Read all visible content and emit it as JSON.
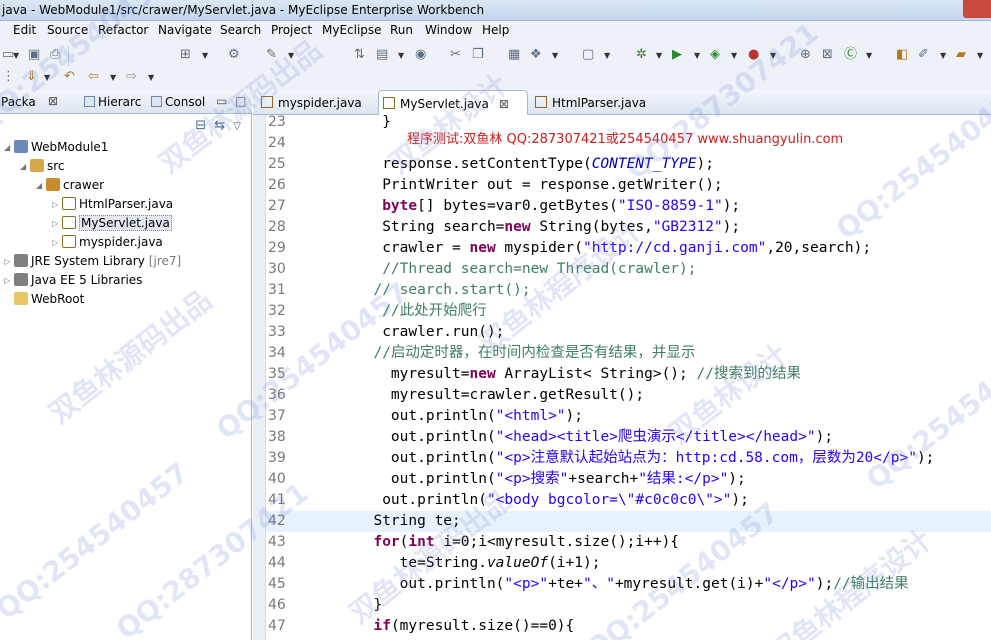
{
  "window": {
    "title": "java - WebModule1/src/crawer/MyServlet.java - MyEclipse Enterprise Workbench"
  },
  "menu": [
    "Edit",
    "Source",
    "Refactor",
    "Navigate",
    "Search",
    "Project",
    "MyEclipse",
    "Run",
    "Window",
    "Help"
  ],
  "left_panel": {
    "tabs": [
      {
        "label": "Packa"
      },
      {
        "label": "Hierarc"
      },
      {
        "label": "Consol"
      }
    ],
    "tree": [
      {
        "label": "WebModule1",
        "depth": 0,
        "icon": "project-icon",
        "twisty": "open"
      },
      {
        "label": "src",
        "depth": 1,
        "icon": "source-folder-icon",
        "twisty": "open"
      },
      {
        "label": "crawer",
        "depth": 2,
        "icon": "package-icon",
        "twisty": "open"
      },
      {
        "label": "HtmlParser.java",
        "depth": 3,
        "icon": "java-file-icon",
        "twisty": "closed"
      },
      {
        "label": "MyServlet.java",
        "depth": 3,
        "icon": "java-file-icon",
        "twisty": "closed",
        "selected": true
      },
      {
        "label": "myspider.java",
        "depth": 3,
        "icon": "java-file-icon",
        "twisty": "closed"
      },
      {
        "label": "JRE System Library",
        "decoration": "[jre7]",
        "depth": 0,
        "icon": "library-icon",
        "twisty": "closed"
      },
      {
        "label": "Java EE 5 Libraries",
        "depth": 0,
        "icon": "library-icon",
        "twisty": "closed"
      },
      {
        "label": "WebRoot",
        "depth": 0,
        "icon": "folder-icon",
        "twisty": "none"
      }
    ]
  },
  "editor": {
    "tabs": [
      {
        "label": "myspider.java",
        "active": false
      },
      {
        "label": "MyServlet.java",
        "active": true
      },
      {
        "label": "HtmlParser.java",
        "active": false
      }
    ],
    "note": "程序测试:双鱼林 QQ:287307421或254540457 www.shuangyulin.com",
    "lines": [
      {
        "n": "23",
        "t": "   }"
      },
      {
        "n": "24",
        "t": ""
      },
      {
        "n": "25",
        "t": "   response.setContentType(CONTENT_TYPE);"
      },
      {
        "n": "26",
        "t": "   PrintWriter out = response.getWriter();"
      },
      {
        "n": "27",
        "t": "   byte[] bytes=var0.getBytes(\"ISO-8859-1\");"
      },
      {
        "n": "28",
        "t": "   String search=new String(bytes,\"GB2312\");"
      },
      {
        "n": "29",
        "t": "   crawler = new myspider(\"http://cd.ganji.com\",20,search);"
      },
      {
        "n": "30",
        "t": "   //Thread search=new Thread(crawler);"
      },
      {
        "n": "31",
        "t": "  // search.start();"
      },
      {
        "n": "32",
        "t": "   //此处开始爬行"
      },
      {
        "n": "33",
        "t": "   crawler.run();"
      },
      {
        "n": "34",
        "t": "  //启动定时器，在时间内检查是否有结果，并显示"
      },
      {
        "n": "35",
        "t": "    myresult=new ArrayList< String>(); //搜索到的结果"
      },
      {
        "n": "36",
        "t": "    myresult=crawler.getResult();"
      },
      {
        "n": "37",
        "t": "    out.println(\"<html>\");"
      },
      {
        "n": "38",
        "t": "    out.println(\"<head><title>爬虫演示</title></head>\");"
      },
      {
        "n": "39",
        "t": "    out.println(\"<p>注意默认起始站点为：http:cd.58.com，层数为20</p>\");"
      },
      {
        "n": "40",
        "t": "    out.println(\"<p>搜索\"+search+\"结果:</p>\");"
      },
      {
        "n": "41",
        "t": "   out.println(\"<body bgcolor=\\\"#c0c0c0\\\">\");"
      },
      {
        "n": "42",
        "t": "  String te;"
      },
      {
        "n": "43",
        "t": "  for(int i=0;i<myresult.size();i++){"
      },
      {
        "n": "44",
        "t": "     te=String.valueOf(i+1);"
      },
      {
        "n": "45",
        "t": "     out.println(\"<p>\"+te+\"、\"+myresult.get(i)+\"</p>\");//输出结果"
      },
      {
        "n": "46",
        "t": "  }"
      },
      {
        "n": "47",
        "t": "  if(myresult.size()==0){"
      }
    ]
  },
  "watermarks": [
    "QQ:254540457",
    "双鱼林源码出品",
    "双鱼林设计",
    "QQ:287307421",
    "双鱼林程序设计"
  ],
  "colors": {
    "keyword": "#7f0055",
    "string": "#2a00ff",
    "comment": "#3f7f5f",
    "note": "#d11b1b",
    "selection": "#e8f2fe"
  }
}
